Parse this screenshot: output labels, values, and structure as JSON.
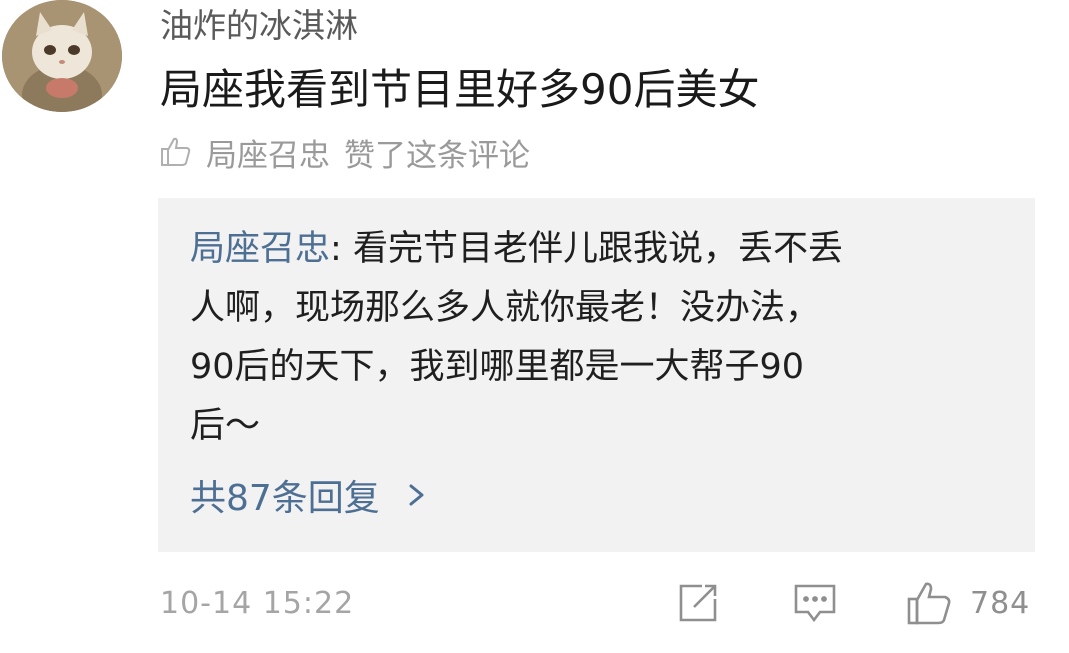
{
  "comment": {
    "username": "油炸的冰淇淋",
    "text": "局座我看到节目里好多90后美女",
    "liked_by": "局座召忠",
    "liked_suffix": "赞了这条评论",
    "timestamp": "10-14 15:22",
    "like_count": "784"
  },
  "reply": {
    "author": "局座召忠",
    "separator": ": ",
    "lines": [
      "看完节目老伴儿跟我说，丢不丢",
      "人啊，现场那么多人就你最老！没办法，",
      "90后的天下，我到哪里都是一大帮子90",
      "后～"
    ],
    "more_label": "共87条回复"
  },
  "icons": {
    "avatar": "cat-avatar",
    "liked": "thumbs-up-outline-icon",
    "more": "chevron-right-icon",
    "share": "share-icon",
    "reply": "comment-icon",
    "like": "thumbs-up-icon"
  },
  "colors": {
    "link": "#4e6f94",
    "reply_background": "#f2f2f2",
    "muted": "#9a9a9a"
  }
}
